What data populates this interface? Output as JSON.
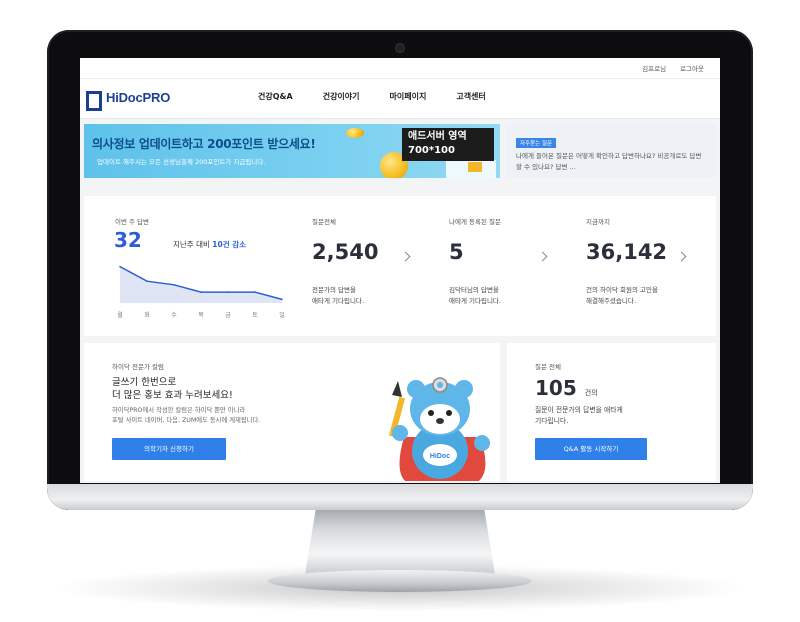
{
  "topbar": {
    "user": "김프로님",
    "logout": "로그아웃"
  },
  "logo": {
    "text": "HiDocPRO"
  },
  "nav": {
    "items": [
      "건강Q&A",
      "건강이야기",
      "마이페이지",
      "고객센터"
    ]
  },
  "banner": {
    "title": "의사정보 업데이트하고 200포인트 받으세요!",
    "subtitle": "업데이트 해주시는 모든 선생님들께 200포인트가 지급됩니다.",
    "ad_title": "애드서버 영역",
    "ad_size": "700*100"
  },
  "faq": {
    "tag": "자주묻는 질문",
    "text": "나에게 들어온 질문은 어떻게 확인하고 답변하나요? 비공개로도 답변할 수 있나요? 답변 ..."
  },
  "stats": {
    "weekly": {
      "label": "이번 주 답변",
      "value": "32",
      "compare_prefix": "지난주 대비",
      "compare_value": "10건 감소"
    },
    "total_questions": {
      "label": "질문전체",
      "value": "2,540",
      "desc": [
        "전문가의 답변을",
        "애타게 기다립니다."
      ]
    },
    "my_questions": {
      "label": "나에게 등록된 질문",
      "value": "5",
      "desc": [
        "김닥터님의 답변을",
        "애타게 기다립니다."
      ]
    },
    "so_far": {
      "label": "지금까지",
      "value": "36,142",
      "desc": [
        "건의 하이닥 회원의 고민을",
        "해결해주셨습니다."
      ]
    }
  },
  "chart_data": {
    "type": "area",
    "categories": [
      "월",
      "화",
      "수",
      "목",
      "금",
      "토",
      "일"
    ],
    "values": [
      10,
      6,
      5,
      3,
      3,
      3,
      1
    ],
    "ylim": [
      0,
      11
    ]
  },
  "column": {
    "label": "하이닥 전문가 칼럼",
    "title_line1": "글쓰기 한번으로",
    "title_line2": "더 많은 홍보 효과 누려보세요!",
    "desc_line1": "하이닥PRO에서 작성한 칼럼은 하이닥 뿐만 아니라",
    "desc_line2": "포털 사이트 네이버, 다음, ZUM에도 동시에 게재됩니다.",
    "button": "의학기자 신청하기",
    "mascot_badge": "HiDoc"
  },
  "qa": {
    "label": "질문 전체",
    "value": "105",
    "unit": "건의",
    "desc_line1": "질문이 전문가의 답변을 애타게",
    "desc_line2": "기다립니다.",
    "button": "Q&A 활동 시작하기"
  },
  "colors": {
    "brand": "#1b3f93",
    "accent": "#2f80e9",
    "chart_fill": "#dfe5f4",
    "chart_line": "#2c5fd6"
  }
}
